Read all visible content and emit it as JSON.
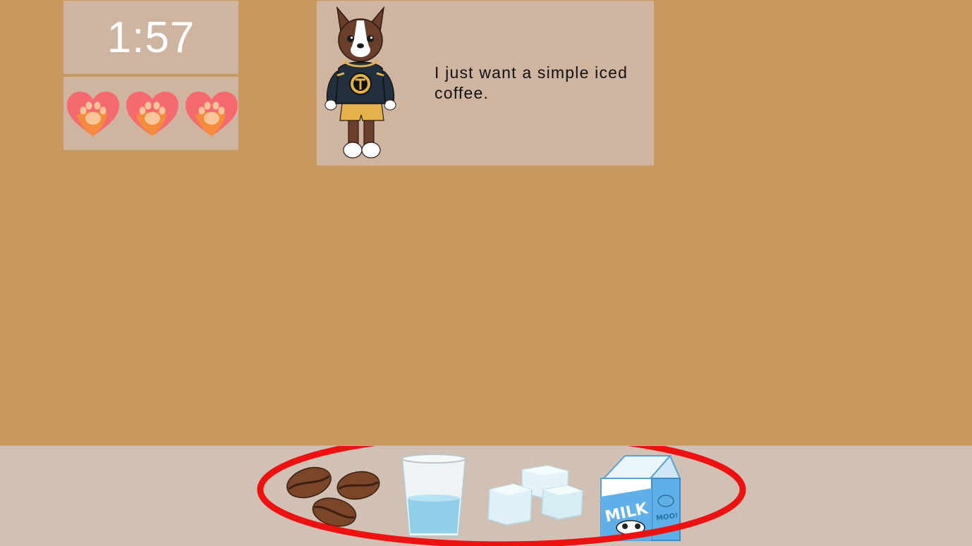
{
  "timer": {
    "value": "1:57"
  },
  "lives": {
    "count": 3,
    "icon": "paw-heart-icon"
  },
  "customer": {
    "character": "boston-terrier-in-bruins-hoodie",
    "speech": "I just want a simple iced coffee."
  },
  "tray": {
    "ingredients": [
      {
        "name": "coffee-beans",
        "icon": "coffee-beans-icon"
      },
      {
        "name": "water",
        "icon": "water-glass-icon"
      },
      {
        "name": "ice",
        "icon": "ice-cubes-icon"
      },
      {
        "name": "milk",
        "icon": "milk-carton-icon",
        "label": "MILK",
        "side_label": "MOO!"
      }
    ]
  },
  "colors": {
    "background": "#c9985f",
    "panel": "#cfb4a0",
    "tray": "#d1c1b4",
    "highlight": "#ee1111"
  }
}
